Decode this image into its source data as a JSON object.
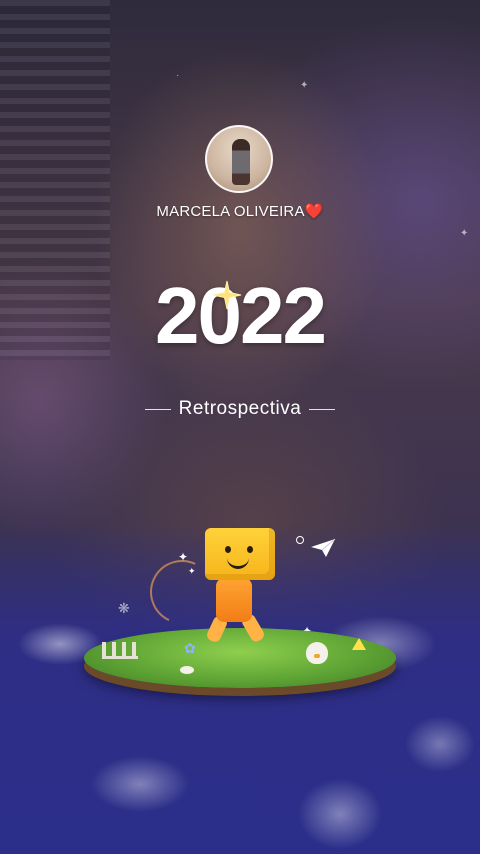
{
  "profile": {
    "username": "MARCELA OLIVEIRA❤️"
  },
  "recap": {
    "year": "2022",
    "subtitle": "Retrospectiva"
  },
  "icons": {
    "avatar": "profile-photo",
    "year_decoration": "sparkle-star-icon",
    "illustration": "mascot-character-on-grass-island",
    "paper_plane": "paper-plane-icon"
  },
  "colors": {
    "text": "#ffffff",
    "mascot_head": "#ffd23a",
    "mascot_body": "#f27d17",
    "grass": "#5fa535"
  }
}
